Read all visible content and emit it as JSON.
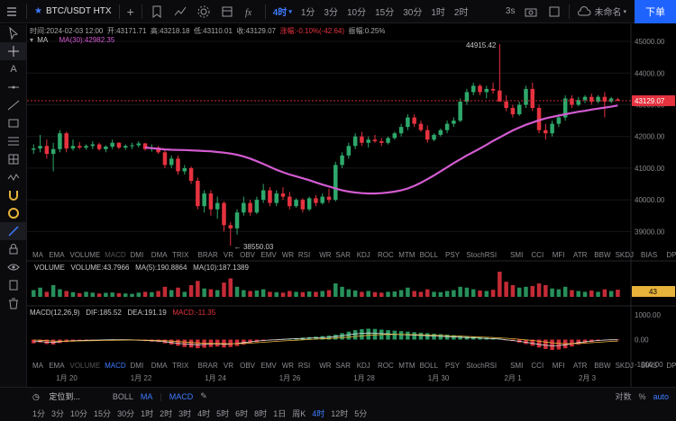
{
  "toolbar": {
    "symbol": "BTC/USDT HTX",
    "interval_active": "4时",
    "intervals": [
      "1分",
      "3分",
      "10分",
      "15分",
      "30分",
      "1时",
      "2时"
    ],
    "refresh": "3s",
    "layout_name": "未命名",
    "order_button": "下单"
  },
  "info": {
    "time": "时间:2024-02-03 12:00",
    "open": "开:43171.71",
    "high": "高:43218.18",
    "low": "低:43110.01",
    "close": "收:43129.07",
    "change": "涨幅:-0.10%(-42.64)",
    "amplitude": "振幅:0.25%",
    "ma_label": "MA",
    "ma_value": "MA(30):42982.35"
  },
  "price_axis": {
    "ticks": [
      "45000.00",
      "44000.00",
      "43000.00",
      "42000.00",
      "41000.00",
      "40000.00",
      "39000.00"
    ],
    "current": "43129.07",
    "current_color": "#e5323f"
  },
  "annotations": {
    "high": "44915.42",
    "low": "38550.03"
  },
  "volume": {
    "title": "VOLUME",
    "vol": "VOLUME:43.7966",
    "ma5": "MA(5):190.8864",
    "ma10": "MA(10):187.1389",
    "badge": "43"
  },
  "macd": {
    "title": "MACD(12,26,9)",
    "dif": "DIF:185.52",
    "dea": "DEA:191.19",
    "macd": "MACD:-11.35",
    "ticks": [
      "1000.00",
      "0.00",
      "-1000.00"
    ]
  },
  "indicator_tabs": [
    "MA",
    "EMA",
    "VOLUME",
    "MACD",
    "DMI",
    "DMA",
    "TRIX",
    "BRAR",
    "VR",
    "OBV",
    "EMV",
    "WR",
    "RSI",
    "WR",
    "SAR",
    "KDJ",
    "ROC",
    "MTM",
    "BOLL",
    "PSY",
    "StochRSI",
    "SMI",
    "CCI",
    "MFI",
    "ATR",
    "BBW",
    "SKDJ",
    "BIAS",
    "DPO",
    "AO"
  ],
  "dates": [
    "1月 20",
    "1月 22",
    "1月 24",
    "1月 26",
    "1月 28",
    "1月 30",
    "2月 1",
    "2月 3"
  ],
  "bottom": {
    "goto": "定位到...",
    "overlays": [
      "BOLL",
      "MA"
    ],
    "sub": "MACD",
    "scale_buttons": [
      "%",
      "auto"
    ],
    "scale_prefix": "对数",
    "timeframes": [
      "1分",
      "3分",
      "10分",
      "15分",
      "30分",
      "1时",
      "2时",
      "3时",
      "4时",
      "5时",
      "6时",
      "8时",
      "1日",
      "周K",
      "4时",
      "12时",
      "5分"
    ],
    "tf_active": 14
  },
  "colors": {
    "up": "#2ea86b",
    "down": "#e5323f",
    "ma": "#d35bd0",
    "accent": "#3d7bff"
  },
  "chart_data": {
    "type": "candlestick",
    "ylim": [
      38300,
      45200
    ],
    "candles": [
      [
        41580,
        41750,
        41450,
        41620
      ],
      [
        41620,
        42050,
        41500,
        41700
      ],
      [
        41700,
        41900,
        41300,
        41450
      ],
      [
        41450,
        41800,
        40900,
        41600
      ],
      [
        41600,
        42200,
        41500,
        42100
      ],
      [
        42100,
        42150,
        41500,
        41620
      ],
      [
        41620,
        41900,
        41550,
        41700
      ],
      [
        41700,
        41820,
        41600,
        41650
      ],
      [
        41650,
        41750,
        41580,
        41700
      ],
      [
        41700,
        41850,
        41600,
        41750
      ],
      [
        41750,
        41800,
        41550,
        41600
      ],
      [
        41600,
        41720,
        41500,
        41680
      ],
      [
        41680,
        41900,
        41600,
        41800
      ],
      [
        41800,
        41820,
        41600,
        41650
      ],
      [
        41650,
        41750,
        41580,
        41700
      ],
      [
        41700,
        41800,
        41600,
        41720
      ],
      [
        41720,
        41850,
        41650,
        41780
      ],
      [
        41780,
        41800,
        41550,
        41600
      ],
      [
        41600,
        41750,
        41520,
        41650
      ],
      [
        41650,
        41700,
        41450,
        41500
      ],
      [
        41500,
        41600,
        41000,
        41100
      ],
      [
        41100,
        41400,
        41000,
        41300
      ],
      [
        41300,
        41400,
        40800,
        40900
      ],
      [
        40900,
        41100,
        40800,
        41000
      ],
      [
        41000,
        41050,
        40500,
        40600
      ],
      [
        40600,
        40700,
        39700,
        39800
      ],
      [
        39800,
        40300,
        39600,
        40200
      ],
      [
        40200,
        40300,
        39500,
        39700
      ],
      [
        39700,
        40100,
        39400,
        39900
      ],
      [
        39900,
        39950,
        39000,
        39200
      ],
      [
        39200,
        39300,
        38550,
        39100
      ],
      [
        39100,
        39700,
        38900,
        39600
      ],
      [
        39600,
        40100,
        39500,
        39900
      ],
      [
        39900,
        40000,
        39500,
        39600
      ],
      [
        39600,
        40100,
        39550,
        40000
      ],
      [
        40000,
        40500,
        39900,
        40300
      ],
      [
        40300,
        40400,
        39800,
        39900
      ],
      [
        39900,
        40300,
        39800,
        40200
      ],
      [
        40200,
        40400,
        40000,
        40100
      ],
      [
        40100,
        40250,
        39700,
        39800
      ],
      [
        39800,
        40050,
        39750,
        40000
      ],
      [
        40000,
        40050,
        39600,
        39700
      ],
      [
        39700,
        40100,
        39650,
        40050
      ],
      [
        40050,
        40150,
        39800,
        39900
      ],
      [
        39900,
        40200,
        39850,
        40100
      ],
      [
        40100,
        40350,
        39900,
        40000
      ],
      [
        40000,
        41200,
        39950,
        41100
      ],
      [
        41100,
        41500,
        41000,
        41400
      ],
      [
        41400,
        41800,
        41300,
        41700
      ],
      [
        41700,
        42100,
        41600,
        42000
      ],
      [
        42000,
        42150,
        41700,
        41800
      ],
      [
        41800,
        42000,
        41650,
        41900
      ],
      [
        41900,
        42050,
        41800,
        41850
      ],
      [
        41850,
        41950,
        41700,
        41800
      ],
      [
        41800,
        42000,
        41750,
        41950
      ],
      [
        41950,
        42150,
        41900,
        42100
      ],
      [
        42100,
        42400,
        42000,
        42300
      ],
      [
        42300,
        42700,
        42200,
        42600
      ],
      [
        42600,
        42700,
        42300,
        42400
      ],
      [
        42400,
        42500,
        42150,
        42200
      ],
      [
        42200,
        42350,
        41800,
        41900
      ],
      [
        41900,
        42100,
        41850,
        42050
      ],
      [
        42050,
        42250,
        42000,
        42200
      ],
      [
        42200,
        42500,
        42100,
        42400
      ],
      [
        42400,
        42600,
        42300,
        42500
      ],
      [
        42500,
        43200,
        42450,
        43100
      ],
      [
        43100,
        43500,
        43000,
        43400
      ],
      [
        43400,
        43700,
        43300,
        43600
      ],
      [
        43600,
        43650,
        43300,
        43400
      ],
      [
        43400,
        43600,
        43200,
        43500
      ],
      [
        43500,
        43700,
        43350,
        43450
      ],
      [
        43450,
        44915,
        43100,
        43100
      ],
      [
        43100,
        43300,
        42800,
        42900
      ],
      [
        42900,
        43000,
        42600,
        42700
      ],
      [
        42700,
        43100,
        42650,
        43000
      ],
      [
        43000,
        43600,
        42900,
        43500
      ],
      [
        43500,
        43700,
        42800,
        42900
      ],
      [
        42900,
        43000,
        42100,
        42200
      ],
      [
        42200,
        42400,
        41900,
        42100
      ],
      [
        42100,
        42500,
        42000,
        42400
      ],
      [
        42400,
        42700,
        42300,
        42600
      ],
      [
        42600,
        43300,
        42500,
        43200
      ],
      [
        43200,
        43300,
        42900,
        43000
      ],
      [
        43000,
        43250,
        42950,
        43150
      ],
      [
        43150,
        43300,
        43050,
        43250
      ],
      [
        43250,
        43350,
        43000,
        43100
      ],
      [
        43100,
        43300,
        43050,
        43250
      ],
      [
        43250,
        43400,
        42600,
        43100
      ],
      [
        43100,
        43250,
        43050,
        43200
      ],
      [
        43172,
        43218,
        43110,
        43129
      ]
    ],
    "ma30": [
      41650,
      41630,
      41610,
      41590,
      41580,
      41575,
      41570,
      41560,
      41550,
      41540,
      41530,
      41510,
      41490,
      41460,
      41420,
      41370,
      41300,
      41220,
      41130,
      41040,
      40950,
      40870,
      40800,
      40740,
      40680,
      40620,
      40550,
      40480,
      40420,
      40360,
      40300,
      40260,
      40230,
      40210,
      40200,
      40200,
      40210,
      40230,
      40260,
      40300,
      40360,
      40440,
      40540,
      40650,
      40770,
      40900,
      41030,
      41160,
      41280,
      41400,
      41510,
      41620,
      41740,
      41860,
      41970,
      42080,
      42190,
      42280,
      42370,
      42440,
      42510,
      42570,
      42620,
      42660,
      42700,
      42740,
      42780,
      42810,
      42850,
      42880,
      42910,
      42940,
      42980
    ],
    "volume": [
      40,
      55,
      30,
      70,
      45,
      35,
      28,
      22,
      30,
      25,
      20,
      24,
      26,
      22,
      20,
      18,
      25,
      30,
      28,
      35,
      60,
      40,
      55,
      30,
      70,
      95,
      50,
      45,
      40,
      85,
      110,
      60,
      40,
      35,
      38,
      45,
      30,
      28,
      25,
      35,
      30,
      28,
      32,
      30,
      35,
      40,
      80,
      60,
      45,
      38,
      30,
      35,
      28,
      25,
      30,
      32,
      40,
      55,
      35,
      30,
      45,
      30,
      28,
      35,
      40,
      60,
      55,
      45,
      38,
      35,
      42,
      150,
      90,
      70,
      55,
      60,
      65,
      80,
      70,
      50,
      45,
      60,
      40,
      35,
      30,
      38,
      30,
      45,
      35,
      43
    ],
    "macd_hist": [
      -150,
      -120,
      -180,
      -200,
      -140,
      -100,
      -80,
      -60,
      -50,
      -40,
      -30,
      -20,
      -15,
      -10,
      -5,
      -20,
      -40,
      -60,
      -80,
      -100,
      -150,
      -200,
      -250,
      -300,
      -320,
      -350,
      -330,
      -300,
      -280,
      -320,
      -300,
      -260,
      -200,
      -150,
      -100,
      -60,
      -30,
      -10,
      20,
      40,
      60,
      80,
      100,
      120,
      140,
      160,
      200,
      260,
      320,
      380,
      420,
      440,
      430,
      400,
      380,
      360,
      340,
      320,
      300,
      280,
      260,
      240,
      220,
      200,
      180,
      160,
      140,
      120,
      100,
      80,
      60,
      40,
      -20,
      -60,
      -120,
      -180,
      -250,
      -320,
      -380,
      -420,
      -400,
      -350,
      -280,
      -200,
      -150,
      -100,
      -60,
      -30,
      -15,
      -11
    ],
    "macd_ylim": [
      -1000,
      1000
    ]
  }
}
